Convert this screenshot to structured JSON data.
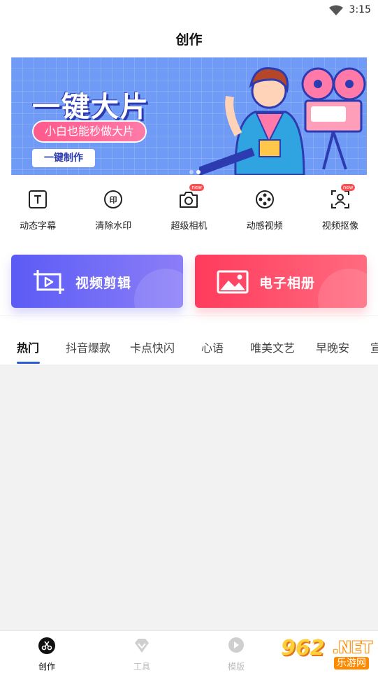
{
  "status_bar": {
    "time": "3:15"
  },
  "header": {
    "title": "创作"
  },
  "banner": {
    "title": "一键大片",
    "subtitle": "小白也能秒做大片",
    "button_label": "一键制作"
  },
  "tools": [
    {
      "label": "动态字幕",
      "icon": "text-icon",
      "is_new": false
    },
    {
      "label": "清除水印",
      "icon": "stamp-icon",
      "is_new": false
    },
    {
      "label": "超级相机",
      "icon": "camera-icon",
      "is_new": true,
      "badge": "new"
    },
    {
      "label": "动感视频",
      "icon": "film-reel-icon",
      "is_new": false
    },
    {
      "label": "视频抠像",
      "icon": "portrait-scan-icon",
      "is_new": true,
      "badge": "new"
    }
  ],
  "actions": {
    "video_edit_label": "视频剪辑",
    "album_label": "电子相册"
  },
  "tabs": [
    {
      "label": "热门",
      "active": true
    },
    {
      "label": "抖音爆款",
      "active": false
    },
    {
      "label": "卡点快闪",
      "active": false
    },
    {
      "label": "心语",
      "active": false
    },
    {
      "label": "唯美文艺",
      "active": false
    },
    {
      "label": "早晚安",
      "active": false
    },
    {
      "label": "宣",
      "active": false
    }
  ],
  "bottom_nav": [
    {
      "label": "创作",
      "icon": "scissors-icon",
      "active": true
    },
    {
      "label": "工具",
      "icon": "diamond-icon",
      "active": false
    },
    {
      "label": "模版",
      "icon": "play-bubble-icon",
      "active": false
    }
  ],
  "watermark": {
    "number": "962",
    "suffix": ".NET",
    "site": "乐游网"
  },
  "colors": {
    "accent": "#2b5bd7",
    "video_button": "#5b5bf5",
    "album_button": "#ff3b5c",
    "banner_bg": "#6f9af5",
    "content_bg": "#f2f2f2"
  }
}
